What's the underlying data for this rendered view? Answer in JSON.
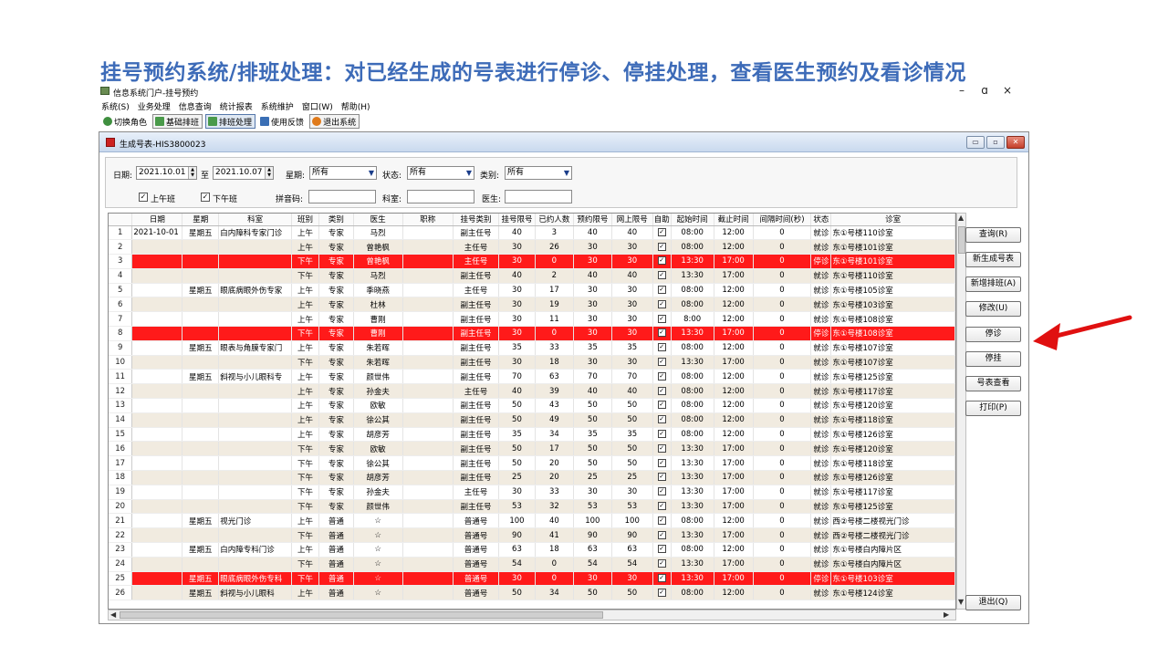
{
  "slide_title": "挂号预约系统/排班处理：对已经生成的号表进行停诊、停挂处理，查看医生预约及看诊情况",
  "window": {
    "title": "信息系统门户-挂号预约",
    "controls": [
      "–",
      "ɑ",
      "×"
    ]
  },
  "menu": [
    "系统(S)",
    "业务处理",
    "信息查询",
    "统计报表",
    "系统维护",
    "窗口(W)",
    "帮助(H)"
  ],
  "toolbar": [
    {
      "label": "切换角色",
      "icon": "switch-role-icon",
      "color": "#3f8f3f"
    },
    {
      "label": "基础排班",
      "icon": "base-schedule-icon",
      "color": "#4a9a4a"
    },
    {
      "label": "排班处理",
      "icon": "schedule-process-icon",
      "color": "#4a9a4a"
    },
    {
      "label": "使用反馈",
      "icon": "feedback-icon",
      "color": "#3a6fb5"
    },
    {
      "label": "退出系统",
      "icon": "exit-icon",
      "color": "#e07a1a"
    }
  ],
  "document": {
    "title": "生成号表-HIS3800023",
    "controls": [
      "▭",
      "▫",
      "✕"
    ]
  },
  "filters": {
    "date_label": "日期:",
    "date_from": "2021.10.01",
    "to_label": "至",
    "date_to": "2021.10.07",
    "weekday_label": "星期:",
    "weekday_value": "所有",
    "status_label": "状态:",
    "status_value": "所有",
    "category_label": "类别:",
    "category_value": "所有",
    "morning_label": "上午班",
    "afternoon_label": "下午班",
    "pinyin_label": "拼音码:",
    "pinyin_value": "",
    "dept_label": "科室:",
    "dept_value": "",
    "doctor_label": "医生:",
    "doctor_value": ""
  },
  "columns": [
    "",
    "日期",
    "星期",
    "科室",
    "班别",
    "类别",
    "医生",
    "职称",
    "挂号类别",
    "挂号限号",
    "已约人数",
    "预约限号",
    "网上限号",
    "自助",
    "起始时间",
    "截止时间",
    "间隔时间(秒)",
    "状态",
    "诊室"
  ],
  "rows": [
    {
      "n": "1",
      "date": "2021-10-01",
      "wd": "星期五",
      "dept": "白内障科专家门诊",
      "shift": "上午",
      "cat": "专家",
      "doc": "马烈",
      "title": "",
      "reg": "副主任号",
      "lim": "40",
      "booked": "3",
      "plim": "40",
      "olim": "40",
      "self": "✓",
      "start": "08:00",
      "end": "12:00",
      "gap": "0",
      "status": "就诊",
      "room": "东①号楼110诊室",
      "stop": false
    },
    {
      "n": "2",
      "date": "",
      "wd": "",
      "dept": "",
      "shift": "上午",
      "cat": "专家",
      "doc": "曾艳枫",
      "title": "",
      "reg": "主任号",
      "lim": "30",
      "booked": "26",
      "plim": "30",
      "olim": "30",
      "self": "✓",
      "start": "08:00",
      "end": "12:00",
      "gap": "0",
      "status": "就诊",
      "room": "东①号楼101诊室",
      "stop": false
    },
    {
      "n": "3",
      "date": "",
      "wd": "",
      "dept": "",
      "shift": "下午",
      "cat": "专家",
      "doc": "曾艳枫",
      "title": "",
      "reg": "主任号",
      "lim": "30",
      "booked": "0",
      "plim": "30",
      "olim": "30",
      "self": "✓",
      "start": "13:30",
      "end": "17:00",
      "gap": "0",
      "status": "停诊",
      "room": "东①号楼101诊室",
      "stop": true
    },
    {
      "n": "4",
      "date": "",
      "wd": "",
      "dept": "",
      "shift": "下午",
      "cat": "专家",
      "doc": "马烈",
      "title": "",
      "reg": "副主任号",
      "lim": "40",
      "booked": "2",
      "plim": "40",
      "olim": "40",
      "self": "✓",
      "start": "13:30",
      "end": "17:00",
      "gap": "0",
      "status": "就诊",
      "room": "东①号楼110诊室",
      "stop": false
    },
    {
      "n": "5",
      "date": "",
      "wd": "星期五",
      "dept": "眼底病眼外伤专家",
      "shift": "上午",
      "cat": "专家",
      "doc": "季晓燕",
      "title": "",
      "reg": "主任号",
      "lim": "30",
      "booked": "17",
      "plim": "30",
      "olim": "30",
      "self": "✓",
      "start": "08:00",
      "end": "12:00",
      "gap": "0",
      "status": "就诊",
      "room": "东①号楼105诊室",
      "stop": false
    },
    {
      "n": "6",
      "date": "",
      "wd": "",
      "dept": "",
      "shift": "上午",
      "cat": "专家",
      "doc": "杜林",
      "title": "",
      "reg": "副主任号",
      "lim": "30",
      "booked": "19",
      "plim": "30",
      "olim": "30",
      "self": "✓",
      "start": "08:00",
      "end": "12:00",
      "gap": "0",
      "status": "就诊",
      "room": "东①号楼103诊室",
      "stop": false
    },
    {
      "n": "7",
      "date": "",
      "wd": "",
      "dept": "",
      "shift": "上午",
      "cat": "专家",
      "doc": "曹刚",
      "title": "",
      "reg": "副主任号",
      "lim": "30",
      "booked": "11",
      "plim": "30",
      "olim": "30",
      "self": "✓",
      "start": "8:00",
      "end": "12:00",
      "gap": "0",
      "status": "就诊",
      "room": "东①号楼108诊室",
      "stop": false
    },
    {
      "n": "8",
      "date": "",
      "wd": "",
      "dept": "",
      "shift": "下午",
      "cat": "专家",
      "doc": "曹刚",
      "title": "",
      "reg": "副主任号",
      "lim": "30",
      "booked": "0",
      "plim": "30",
      "olim": "30",
      "self": "✓",
      "start": "13:30",
      "end": "17:00",
      "gap": "0",
      "status": "停诊",
      "room": "东①号楼108诊室",
      "stop": true
    },
    {
      "n": "9",
      "date": "",
      "wd": "星期五",
      "dept": "眼表与角膜专家门",
      "shift": "上午",
      "cat": "专家",
      "doc": "朱若晖",
      "title": "",
      "reg": "副主任号",
      "lim": "35",
      "booked": "33",
      "plim": "35",
      "olim": "35",
      "self": "✓",
      "start": "08:00",
      "end": "12:00",
      "gap": "0",
      "status": "就诊",
      "room": "东①号楼107诊室",
      "stop": false
    },
    {
      "n": "10",
      "date": "",
      "wd": "",
      "dept": "",
      "shift": "下午",
      "cat": "专家",
      "doc": "朱若晖",
      "title": "",
      "reg": "副主任号",
      "lim": "30",
      "booked": "18",
      "plim": "30",
      "olim": "30",
      "self": "✓",
      "start": "13:30",
      "end": "17:00",
      "gap": "0",
      "status": "就诊",
      "room": "东①号楼107诊室",
      "stop": false
    },
    {
      "n": "11",
      "date": "",
      "wd": "星期五",
      "dept": "斜视与小儿眼科专",
      "shift": "上午",
      "cat": "专家",
      "doc": "颜世伟",
      "title": "",
      "reg": "副主任号",
      "lim": "70",
      "booked": "63",
      "plim": "70",
      "olim": "70",
      "self": "✓",
      "start": "08:00",
      "end": "12:00",
      "gap": "0",
      "status": "就诊",
      "room": "东①号楼125诊室",
      "stop": false
    },
    {
      "n": "12",
      "date": "",
      "wd": "",
      "dept": "",
      "shift": "上午",
      "cat": "专家",
      "doc": "孙金夫",
      "title": "",
      "reg": "主任号",
      "lim": "40",
      "booked": "39",
      "plim": "40",
      "olim": "40",
      "self": "✓",
      "start": "08:00",
      "end": "12:00",
      "gap": "0",
      "status": "就诊",
      "room": "东①号楼117诊室",
      "stop": false
    },
    {
      "n": "13",
      "date": "",
      "wd": "",
      "dept": "",
      "shift": "上午",
      "cat": "专家",
      "doc": "欧敏",
      "title": "",
      "reg": "副主任号",
      "lim": "50",
      "booked": "43",
      "plim": "50",
      "olim": "50",
      "self": "✓",
      "start": "08:00",
      "end": "12:00",
      "gap": "0",
      "status": "就诊",
      "room": "东①号楼120诊室",
      "stop": false
    },
    {
      "n": "14",
      "date": "",
      "wd": "",
      "dept": "",
      "shift": "上午",
      "cat": "专家",
      "doc": "徐公其",
      "title": "",
      "reg": "副主任号",
      "lim": "50",
      "booked": "49",
      "plim": "50",
      "olim": "50",
      "self": "✓",
      "start": "08:00",
      "end": "12:00",
      "gap": "0",
      "status": "就诊",
      "room": "东①号楼118诊室",
      "stop": false
    },
    {
      "n": "15",
      "date": "",
      "wd": "",
      "dept": "",
      "shift": "上午",
      "cat": "专家",
      "doc": "胡彦芳",
      "title": "",
      "reg": "副主任号",
      "lim": "35",
      "booked": "34",
      "plim": "35",
      "olim": "35",
      "self": "✓",
      "start": "08:00",
      "end": "12:00",
      "gap": "0",
      "status": "就诊",
      "room": "东①号楼126诊室",
      "stop": false
    },
    {
      "n": "16",
      "date": "",
      "wd": "",
      "dept": "",
      "shift": "下午",
      "cat": "专家",
      "doc": "欧敏",
      "title": "",
      "reg": "副主任号",
      "lim": "50",
      "booked": "17",
      "plim": "50",
      "olim": "50",
      "self": "✓",
      "start": "13:30",
      "end": "17:00",
      "gap": "0",
      "status": "就诊",
      "room": "东①号楼120诊室",
      "stop": false
    },
    {
      "n": "17",
      "date": "",
      "wd": "",
      "dept": "",
      "shift": "下午",
      "cat": "专家",
      "doc": "徐公其",
      "title": "",
      "reg": "副主任号",
      "lim": "50",
      "booked": "20",
      "plim": "50",
      "olim": "50",
      "self": "✓",
      "start": "13:30",
      "end": "17:00",
      "gap": "0",
      "status": "就诊",
      "room": "东①号楼118诊室",
      "stop": false
    },
    {
      "n": "18",
      "date": "",
      "wd": "",
      "dept": "",
      "shift": "下午",
      "cat": "专家",
      "doc": "胡彦芳",
      "title": "",
      "reg": "副主任号",
      "lim": "25",
      "booked": "20",
      "plim": "25",
      "olim": "25",
      "self": "✓",
      "start": "13:30",
      "end": "17:00",
      "gap": "0",
      "status": "就诊",
      "room": "东①号楼126诊室",
      "stop": false
    },
    {
      "n": "19",
      "date": "",
      "wd": "",
      "dept": "",
      "shift": "下午",
      "cat": "专家",
      "doc": "孙金夫",
      "title": "",
      "reg": "主任号",
      "lim": "30",
      "booked": "33",
      "plim": "30",
      "olim": "30",
      "self": "✓",
      "start": "13:30",
      "end": "17:00",
      "gap": "0",
      "status": "就诊",
      "room": "东①号楼117诊室",
      "stop": false
    },
    {
      "n": "20",
      "date": "",
      "wd": "",
      "dept": "",
      "shift": "下午",
      "cat": "专家",
      "doc": "颜世伟",
      "title": "",
      "reg": "副主任号",
      "lim": "53",
      "booked": "32",
      "plim": "53",
      "olim": "53",
      "self": "✓",
      "start": "13:30",
      "end": "17:00",
      "gap": "0",
      "status": "就诊",
      "room": "东①号楼125诊室",
      "stop": false
    },
    {
      "n": "21",
      "date": "",
      "wd": "星期五",
      "dept": "视光门诊",
      "shift": "上午",
      "cat": "普通",
      "doc": "☆",
      "title": "",
      "reg": "普通号",
      "lim": "100",
      "booked": "40",
      "plim": "100",
      "olim": "100",
      "self": "✓",
      "start": "08:00",
      "end": "12:00",
      "gap": "0",
      "status": "就诊",
      "room": "西②号楼二楼视光门诊",
      "stop": false
    },
    {
      "n": "22",
      "date": "",
      "wd": "",
      "dept": "",
      "shift": "下午",
      "cat": "普通",
      "doc": "☆",
      "title": "",
      "reg": "普通号",
      "lim": "90",
      "booked": "41",
      "plim": "90",
      "olim": "90",
      "self": "✓",
      "start": "13:30",
      "end": "17:00",
      "gap": "0",
      "status": "就诊",
      "room": "西②号楼二楼视光门诊",
      "stop": false
    },
    {
      "n": "23",
      "date": "",
      "wd": "星期五",
      "dept": "白内障专科门诊",
      "shift": "上午",
      "cat": "普通",
      "doc": "☆",
      "title": "",
      "reg": "普通号",
      "lim": "63",
      "booked": "18",
      "plim": "63",
      "olim": "63",
      "self": "✓",
      "start": "08:00",
      "end": "12:00",
      "gap": "0",
      "status": "就诊",
      "room": "东①号楼白内障片区",
      "stop": false
    },
    {
      "n": "24",
      "date": "",
      "wd": "",
      "dept": "",
      "shift": "下午",
      "cat": "普通",
      "doc": "☆",
      "title": "",
      "reg": "普通号",
      "lim": "54",
      "booked": "0",
      "plim": "54",
      "olim": "54",
      "self": "✓",
      "start": "13:30",
      "end": "17:00",
      "gap": "0",
      "status": "就诊",
      "room": "东①号楼白内障片区",
      "stop": false
    },
    {
      "n": "25",
      "date": "",
      "wd": "星期五",
      "dept": "眼底病眼外伤专科",
      "shift": "下午",
      "cat": "普通",
      "doc": "☆",
      "title": "",
      "reg": "普通号",
      "lim": "30",
      "booked": "0",
      "plim": "30",
      "olim": "30",
      "self": "✓",
      "start": "13:30",
      "end": "17:00",
      "gap": "0",
      "status": "停诊",
      "room": "东①号楼103诊室",
      "stop": true
    },
    {
      "n": "26",
      "date": "",
      "wd": "星期五",
      "dept": "斜视与小儿眼科",
      "shift": "上午",
      "cat": "普通",
      "doc": "☆",
      "title": "",
      "reg": "普通号",
      "lim": "50",
      "booked": "34",
      "plim": "50",
      "olim": "50",
      "self": "✓",
      "start": "08:00",
      "end": "12:00",
      "gap": "0",
      "status": "就诊",
      "room": "东①号楼124诊室",
      "stop": false
    }
  ],
  "side_buttons": [
    {
      "name": "query-button",
      "label": "查询(R)"
    },
    {
      "name": "new-schedule-button",
      "label": "新生成号表"
    },
    {
      "name": "add-schedule-button",
      "label": "新增排班(A)"
    },
    {
      "name": "modify-button",
      "label": "修改(U)"
    },
    {
      "name": "stop-clinic-button",
      "label": "停诊"
    },
    {
      "name": "stop-register-button",
      "label": "停挂"
    },
    {
      "name": "view-schedule-button",
      "label": "号表查看"
    },
    {
      "name": "print-button",
      "label": "打印(P)"
    }
  ],
  "exit_button": "退出(Q)",
  "colors": {
    "title": "#3d6bb8",
    "stopped_row": "#ff1a1a",
    "even_row": "#f1ebe0",
    "arrow": "#e01010"
  }
}
